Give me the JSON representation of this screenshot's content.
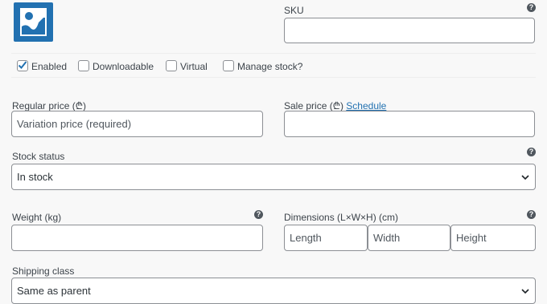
{
  "sku": {
    "label": "SKU",
    "value": "",
    "help": "?"
  },
  "options": [
    {
      "label": "Enabled",
      "checked": true
    },
    {
      "label": "Downloadable",
      "checked": false
    },
    {
      "label": "Virtual",
      "checked": false
    },
    {
      "label": "Manage stock?",
      "checked": false
    }
  ],
  "regular_price": {
    "label": "Regular price (₾)",
    "placeholder": "Variation price (required)",
    "value": ""
  },
  "sale_price": {
    "label": "Sale price (₾)",
    "schedule_link": "Schedule",
    "value": ""
  },
  "stock_status": {
    "label": "Stock status",
    "selected": "In stock",
    "help": "?"
  },
  "weight": {
    "label": "Weight (kg)",
    "value": "",
    "help": "?"
  },
  "dimensions": {
    "label": "Dimensions (L×W×H) (cm)",
    "help": "?",
    "length_placeholder": "Length",
    "width_placeholder": "Width",
    "height_placeholder": "Height"
  },
  "shipping_class": {
    "label": "Shipping class",
    "selected": "Same as parent"
  },
  "colors": {
    "accent": "#2271b1",
    "link": "#2271b1",
    "border": "#8c8f94"
  },
  "icons": {
    "thumbnail": "image-placeholder-icon",
    "help": "help-icon",
    "dropdown": "chevron-down-icon",
    "check": "checkmark-icon"
  }
}
